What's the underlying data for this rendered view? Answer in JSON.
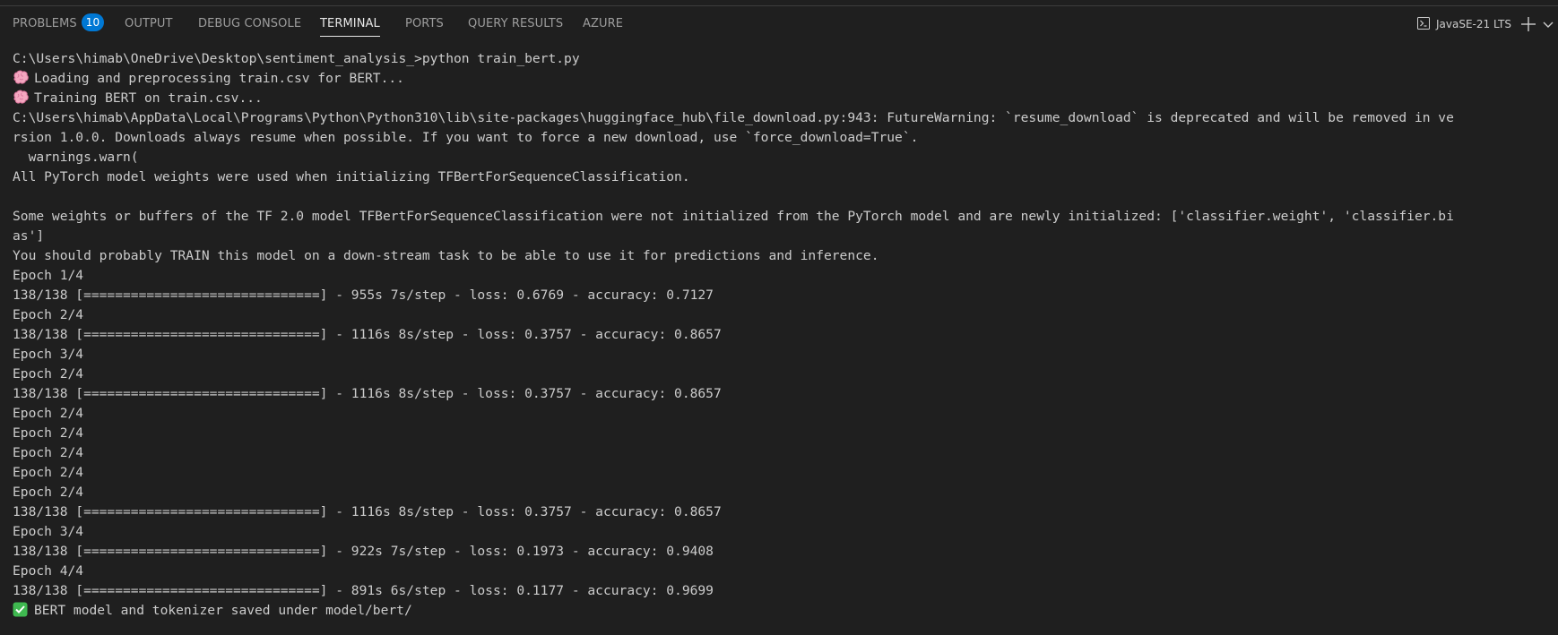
{
  "panel": {
    "tabs": [
      {
        "label": "PROBLEMS",
        "badge": "10"
      },
      {
        "label": "OUTPUT"
      },
      {
        "label": "DEBUG CONSOLE"
      },
      {
        "label": "TERMINAL"
      },
      {
        "label": "PORTS"
      },
      {
        "label": "QUERY RESULTS"
      },
      {
        "label": "AZURE"
      }
    ],
    "active_tab": "TERMINAL",
    "terminal_selector": {
      "icon": "terminal-icon",
      "label": "JavaSE-21 LTS"
    },
    "actions": {
      "add_icon": "plus-icon",
      "dropdown_icon": "chevron-down-icon"
    }
  },
  "terminal": {
    "emoji_icons": {
      "brain": "brain-emoji-icon",
      "check": "check-mark-emoji-icon"
    },
    "lines": [
      "C:\\Users\\himab\\OneDrive\\Desktop\\sentiment_analysis_>python train_bert.py",
      "Loading and preprocessing train.csv for BERT...",
      "Training BERT on train.csv...",
      "C:\\Users\\himab\\AppData\\Local\\Programs\\Python\\Python310\\lib\\site-packages\\huggingface_hub\\file_download.py:943: FutureWarning: `resume_download` is deprecated and will be removed in ve",
      "rsion 1.0.0. Downloads always resume when possible. If you want to force a new download, use `force_download=True`.",
      "  warnings.warn(",
      "All PyTorch model weights were used when initializing TFBertForSequenceClassification.",
      "",
      "Some weights or buffers of the TF 2.0 model TFBertForSequenceClassification were not initialized from the PyTorch model and are newly initialized: ['classifier.weight', 'classifier.bi",
      "as']",
      "You should probably TRAIN this model on a down-stream task to be able to use it for predictions and inference.",
      "Epoch 1/4",
      "138/138 [==============================] - 955s 7s/step - loss: 0.6769 - accuracy: 0.7127",
      "Epoch 2/4",
      "138/138 [==============================] - 1116s 8s/step - loss: 0.3757 - accuracy: 0.8657",
      "Epoch 3/4",
      "Epoch 2/4",
      "138/138 [==============================] - 1116s 8s/step - loss: 0.3757 - accuracy: 0.8657",
      "Epoch 2/4",
      "Epoch 2/4",
      "Epoch 2/4",
      "Epoch 2/4",
      "Epoch 2/4",
      "138/138 [==============================] - 1116s 8s/step - loss: 0.3757 - accuracy: 0.8657",
      "Epoch 3/4",
      "138/138 [==============================] - 922s 7s/step - loss: 0.1973 - accuracy: 0.9408",
      "Epoch 4/4",
      "138/138 [==============================] - 891s 6s/step - loss: 0.1177 - accuracy: 0.9699",
      "BERT model and tokenizer saved under model/bert/"
    ]
  }
}
